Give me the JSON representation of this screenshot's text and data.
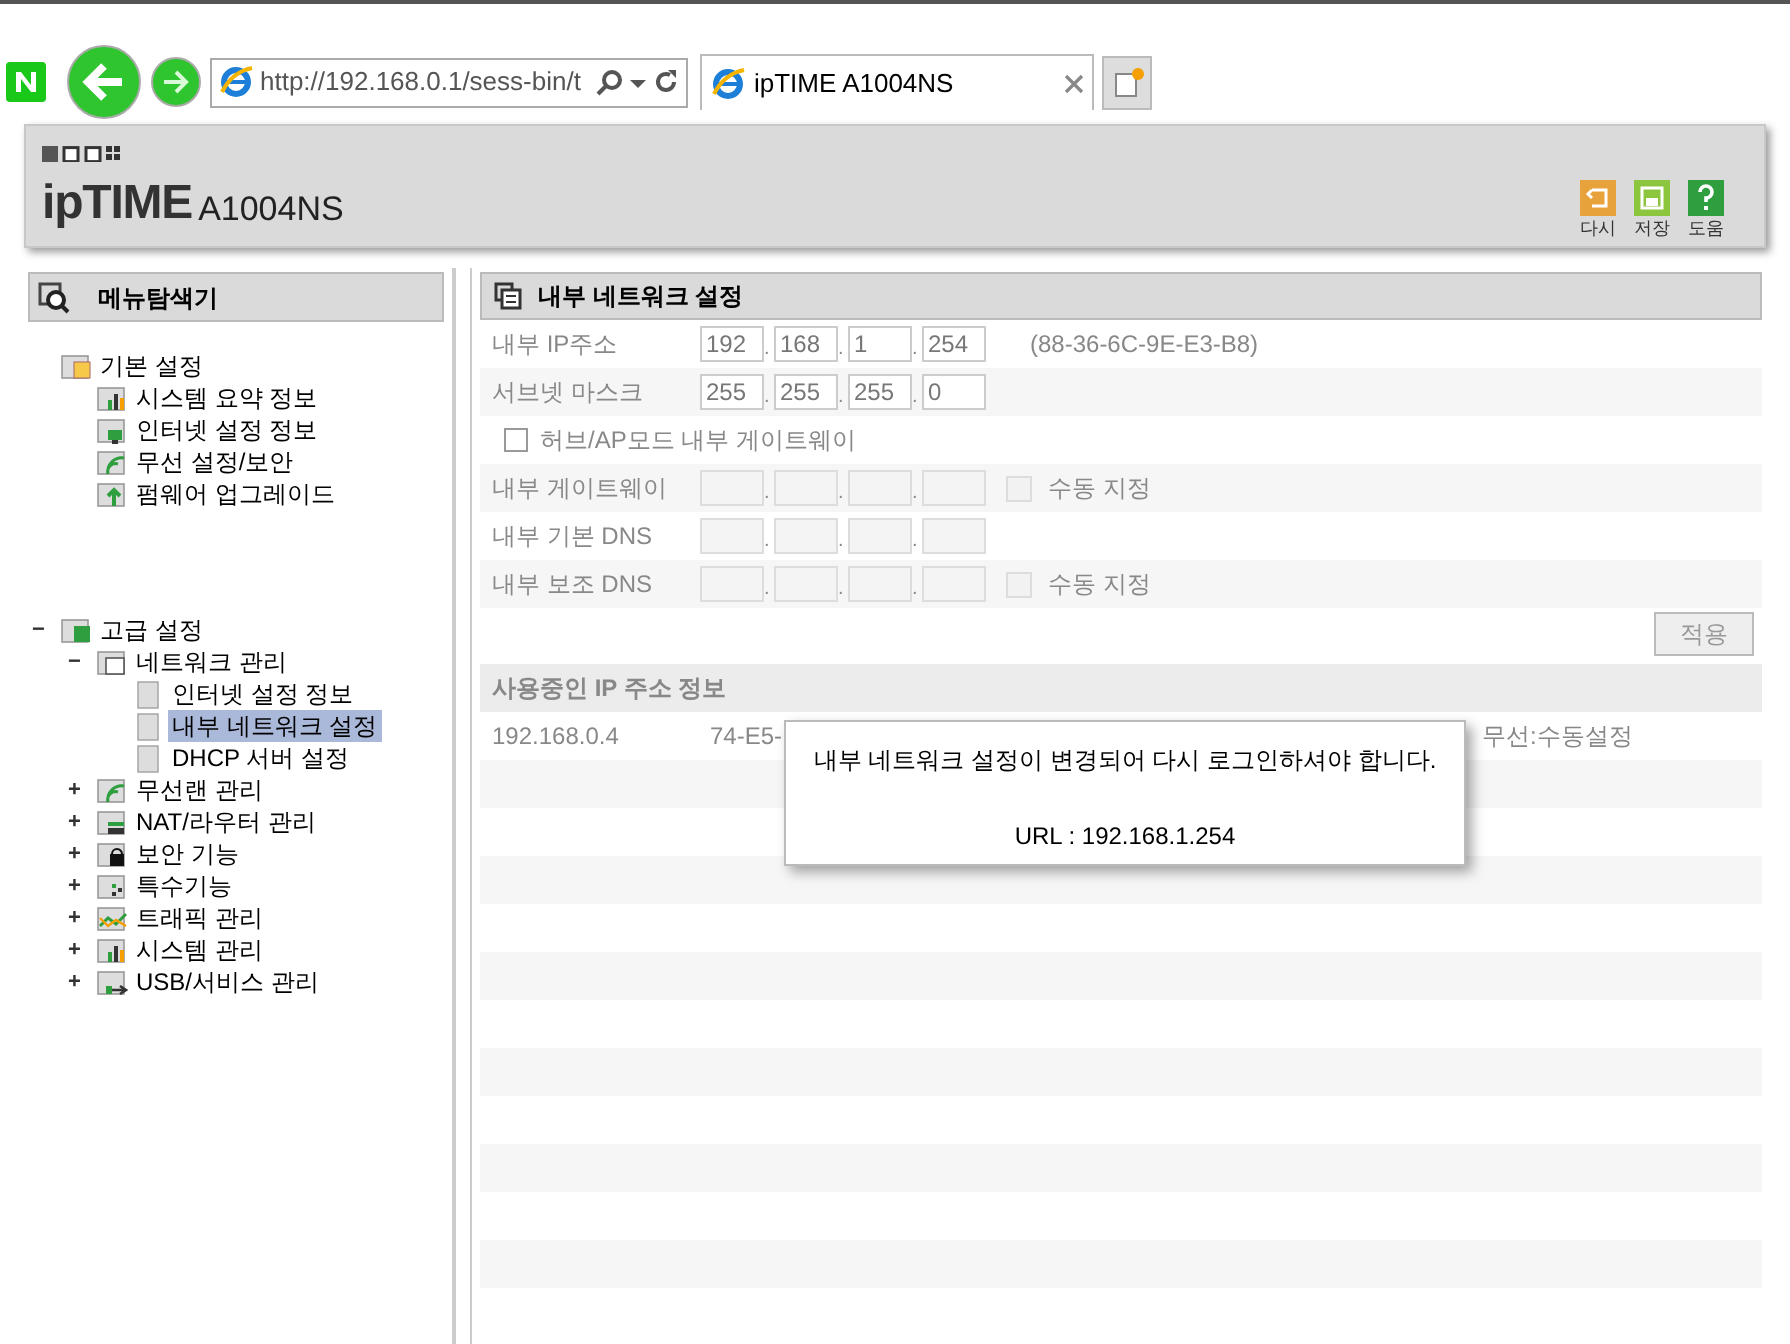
{
  "browser": {
    "address": "http://192.168.0.1/sess-bin/t",
    "tab_title": "ipTIME A1004NS"
  },
  "header": {
    "logo": "ipTIME",
    "model": "A1004NS",
    "actions": [
      {
        "label": "다시",
        "kind": "back"
      },
      {
        "label": "저장",
        "kind": "save"
      },
      {
        "label": "도움",
        "kind": "help"
      }
    ]
  },
  "sidebar": {
    "title": "메뉴탐색기",
    "tree": [
      {
        "label": "기본 설정",
        "children": [
          {
            "label": "시스템 요약 정보"
          },
          {
            "label": "인터넷 설정 정보"
          },
          {
            "label": "무선 설정/보안"
          },
          {
            "label": "펌웨어 업그레이드"
          }
        ]
      },
      {
        "label": "고급 설정",
        "toggle": "−",
        "children": [
          {
            "label": "네트워크 관리",
            "toggle": "−",
            "children": [
              {
                "label": "인터넷 설정 정보",
                "selected": false
              },
              {
                "label": "내부 네트워크 설정",
                "selected": true
              },
              {
                "label": "DHCP 서버 설정",
                "selected": false
              }
            ]
          },
          {
            "label": "무선랜 관리",
            "toggle": "+"
          },
          {
            "label": "NAT/라우터 관리",
            "toggle": "+"
          },
          {
            "label": "보안 기능",
            "toggle": "+"
          },
          {
            "label": "특수기능",
            "toggle": "+"
          },
          {
            "label": "트래픽 관리",
            "toggle": "+"
          },
          {
            "label": "시스템 관리",
            "toggle": "+"
          },
          {
            "label": "USB/서비스 관리",
            "toggle": "+"
          }
        ]
      }
    ]
  },
  "panel": {
    "title": "내부 네트워크 설정",
    "rows": [
      {
        "kind": "ip",
        "label": "내부 IP주소",
        "disabled": false,
        "separators": [
          ".",
          ".",
          "."
        ],
        "octets": [
          "192",
          "168",
          "1",
          "254"
        ],
        "note": "(88-36-6C-9E-E3-B8)"
      },
      {
        "kind": "ip",
        "label": "서브넷 마스크",
        "disabled": false,
        "separators": [
          ".",
          ".",
          "."
        ],
        "octets": [
          "255",
          "255",
          "255",
          "0"
        ]
      },
      {
        "kind": "checkbox",
        "label": "허브/AP모드 내부 게이트웨이",
        "checked": false
      },
      {
        "kind": "ip",
        "label": "내부 게이트웨이",
        "disabled": true,
        "separators": [
          ".",
          ".",
          "."
        ],
        "manual": {
          "label": "수동 지정",
          "checked": false
        }
      },
      {
        "kind": "ip",
        "label": "내부 기본 DNS",
        "disabled": true,
        "separators": [
          ".",
          ".",
          "."
        ]
      },
      {
        "kind": "ip",
        "label": "내부 보조 DNS",
        "disabled": true,
        "separators": [
          ".",
          ".",
          "."
        ],
        "manual": {
          "label": "수동 지정",
          "checked": false
        }
      }
    ],
    "apply_button": "적용",
    "ip_section": {
      "title": "사용중인 IP 주소 정보",
      "rows": [
        [
          "192.168.0.4",
          "74-E5-",
          "무선:수동설정"
        ]
      ]
    }
  },
  "dialog": {
    "message": "내부 네트워크 설정이 변경되어 다시 로그인하셔야 합니다.",
    "url": "URL : 192.168.1.254"
  }
}
